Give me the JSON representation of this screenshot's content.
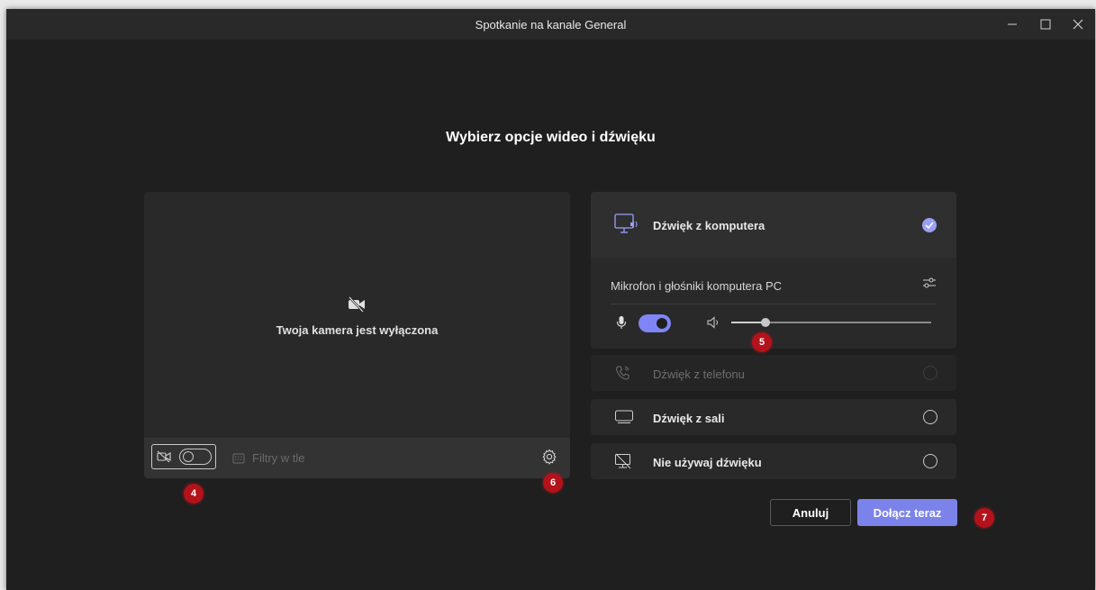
{
  "window": {
    "title": "Spotkanie na kanale General"
  },
  "heading": "Wybierz opcje wideo i dźwięku",
  "video": {
    "camera_off_message": "Twoja kamera jest wyłączona",
    "camera_toggle": "off",
    "background_filters_label": "Filtry w tle"
  },
  "audio": {
    "options": [
      {
        "label": "Dźwięk z komputera",
        "icon": "computer-audio-icon",
        "selected": true,
        "enabled": true
      },
      {
        "label": "Dźwięk z telefonu",
        "icon": "phone-icon",
        "selected": false,
        "enabled": false
      },
      {
        "label": "Dźwięk z sali",
        "icon": "room-audio-icon",
        "selected": false,
        "enabled": true
      },
      {
        "label": "Nie używaj dźwięku",
        "icon": "no-audio-icon",
        "selected": false,
        "enabled": true
      }
    ],
    "device_label": "Mikrofon i głośniki komputera PC",
    "microphone_on": true,
    "speaker_volume": 0.17
  },
  "buttons": {
    "cancel_label": "Anuluj",
    "join_label": "Dołącz teraz"
  },
  "badges": {
    "b4": "4",
    "b5": "5",
    "b6": "6",
    "b7": "7"
  },
  "colors": {
    "accent": "#7b83eb",
    "background": "#1f1f1f",
    "panel": "#292929",
    "badge": "#b3121b"
  }
}
